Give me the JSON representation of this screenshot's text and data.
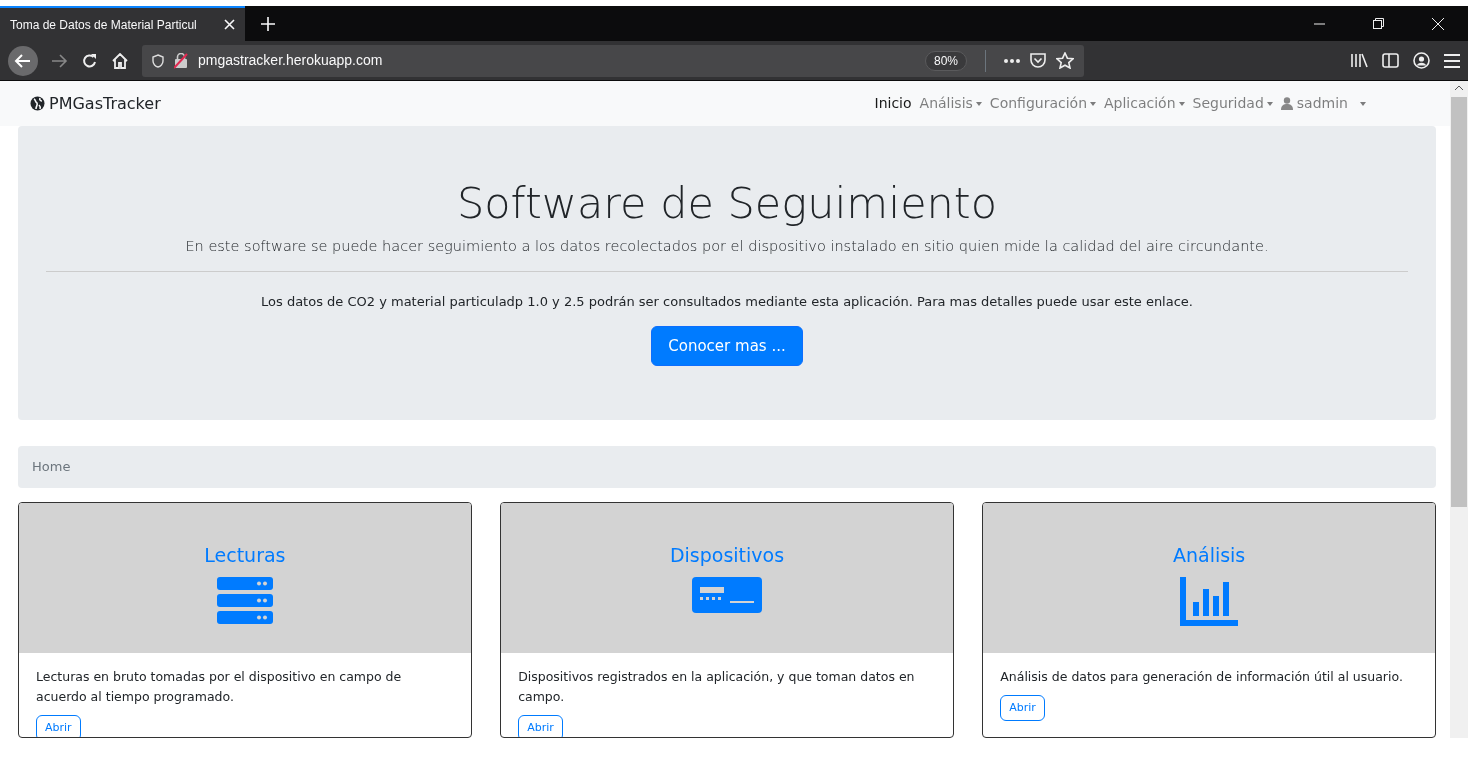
{
  "browser": {
    "tab_title": "Toma de Datos de Material Particul",
    "url": "pmgastracker.herokuapp.com",
    "zoom": "80%"
  },
  "navbar": {
    "brand": "PMGasTracker",
    "items": [
      {
        "label": "Inicio",
        "selected": true,
        "dropdown": false
      },
      {
        "label": "Análisis",
        "selected": false,
        "dropdown": true
      },
      {
        "label": "Configuración",
        "selected": false,
        "dropdown": true
      },
      {
        "label": "Aplicación",
        "selected": false,
        "dropdown": true
      },
      {
        "label": "Seguridad",
        "selected": false,
        "dropdown": true
      }
    ],
    "user": "sadmin"
  },
  "jumbotron": {
    "title": "Software de Seguimiento",
    "lead": "En este software se puede hacer seguimiento a los datos recolectados por el dispositivo instalado en sitio quien mide la calidad del aire circundante.",
    "text": "Los datos de CO2 y material particuladp 1.0 y 2.5 podrán ser consultados mediante esta aplicación. Para mas detalles puede usar este enlace.",
    "button": "Conocer mas ..."
  },
  "breadcrumb": [
    "Home"
  ],
  "cards": [
    {
      "title": "Lecturas",
      "kind": "server",
      "text": "Lecturas en bruto tomadas por el dispositivo en campo de acuerdo al tiempo programado.",
      "button": "Abrir"
    },
    {
      "title": "Dispositivos",
      "kind": "device",
      "text": "Dispositivos registrados en la aplicación, y que toman datos en campo.",
      "button": "Abrir"
    },
    {
      "title": "Análisis",
      "kind": "chart",
      "text": "Análisis de datos para generación de información útil al usuario.",
      "button": "Abrir"
    }
  ]
}
